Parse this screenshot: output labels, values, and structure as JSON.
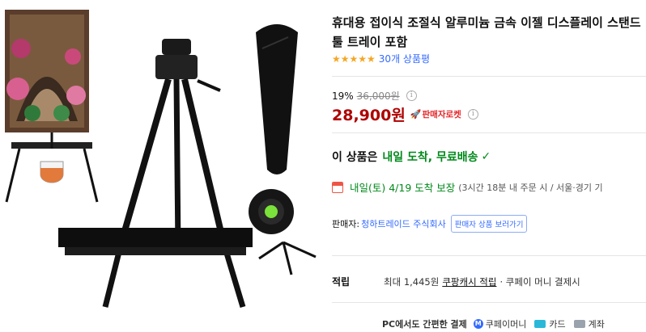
{
  "product": {
    "title": "휴대용 접이식 조절식 알루미늄 금속 이젤 디스플레이 스탠드 툴 트레이 포함",
    "rating_stars": "★★★★★",
    "review_count": "30개 상품평",
    "discount_rate": "19%",
    "original_price": "36,000원",
    "sale_price": "28,900원",
    "rocket_label": "판매자로켓",
    "info_icon_glyph": "i"
  },
  "delivery": {
    "prefix": "이 상품은",
    "highlight": "내일 도착, 무료배송",
    "check_glyph": "✓",
    "arrival_date": "내일(토) 4/19 도착 보장",
    "arrival_note": "(3시간 18분  내 주문 시 / 서울·경기 기"
  },
  "seller": {
    "label": "판매자:",
    "name": "청하트레이드 주식회사",
    "button": "판매자 상품 보러가기"
  },
  "points": {
    "label": "적립",
    "text": "최대 1,445원",
    "link": "쿠팡캐시 적립",
    "suffix": "· 쿠페이 머니 결제시"
  },
  "payment": {
    "label": "PC에서도 간편한 결제",
    "coupay_badge": "M",
    "coupay": "쿠페이머니",
    "card": "카드",
    "bank": "계좌"
  },
  "colors": {
    "price_red": "#ae0000",
    "delivery_green": "#00891a",
    "link_blue": "#346aff",
    "star_gold": "#f5a623"
  }
}
